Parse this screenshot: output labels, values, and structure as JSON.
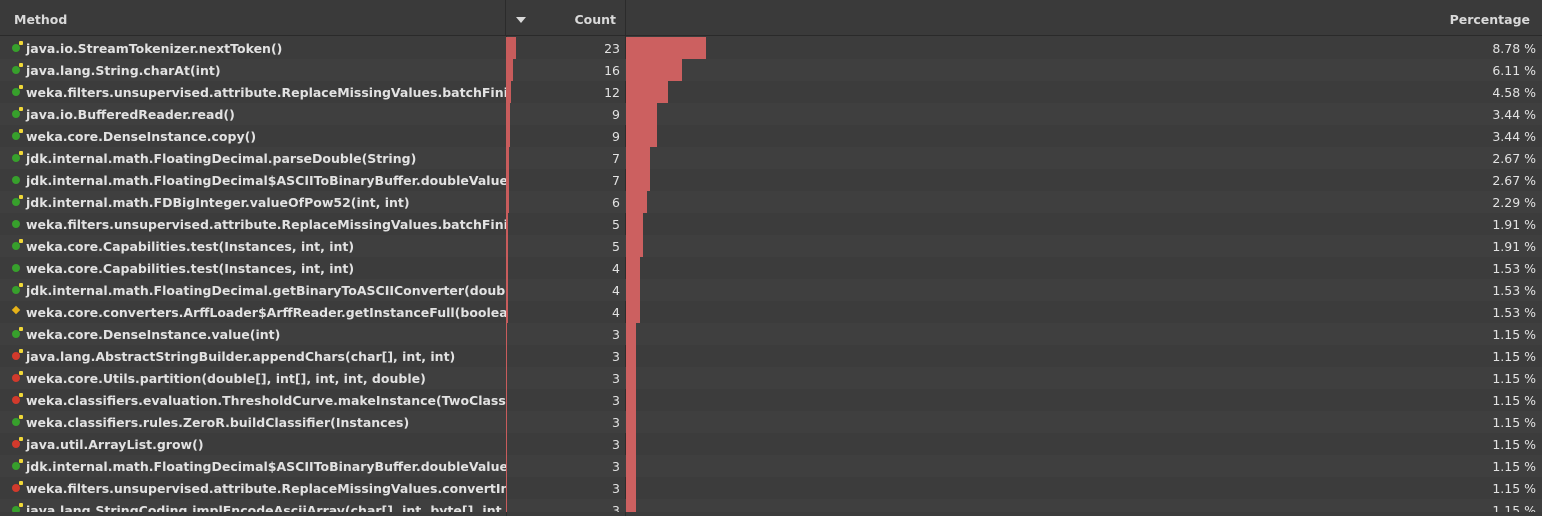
{
  "columns": {
    "method": "Method",
    "count": "Count",
    "percentage": "Percentage"
  },
  "rows": [
    {
      "method": "java.io.StreamTokenizer.nextToken()",
      "count": "23",
      "pct": "8.78 %",
      "frac": 0.0878,
      "icon": "green-arrow"
    },
    {
      "method": "java.lang.String.charAt(int)",
      "count": "16",
      "pct": "6.11 %",
      "frac": 0.0611,
      "icon": "green-arrow"
    },
    {
      "method": "weka.filters.unsupervised.attribute.ReplaceMissingValues.batchFinished()",
      "count": "12",
      "pct": "4.58 %",
      "frac": 0.0458,
      "icon": "green-arrow"
    },
    {
      "method": "java.io.BufferedReader.read()",
      "count": "9",
      "pct": "3.44 %",
      "frac": 0.0344,
      "icon": "green-arrow"
    },
    {
      "method": "weka.core.DenseInstance.copy()",
      "count": "9",
      "pct": "3.44 %",
      "frac": 0.0344,
      "icon": "green-arrow"
    },
    {
      "method": "jdk.internal.math.FloatingDecimal.parseDouble(String)",
      "count": "7",
      "pct": "2.67 %",
      "frac": 0.0267,
      "icon": "green-arrow"
    },
    {
      "method": "jdk.internal.math.FloatingDecimal$ASCIIToBinaryBuffer.doubleValue()",
      "count": "7",
      "pct": "2.67 %",
      "frac": 0.0267,
      "icon": "green"
    },
    {
      "method": "jdk.internal.math.FDBigInteger.valueOfPow52(int, int)",
      "count": "6",
      "pct": "2.29 %",
      "frac": 0.0229,
      "icon": "green-arrow"
    },
    {
      "method": "weka.filters.unsupervised.attribute.ReplaceMissingValues.batchFinished()",
      "count": "5",
      "pct": "1.91 %",
      "frac": 0.0191,
      "icon": "green"
    },
    {
      "method": "weka.core.Capabilities.test(Instances, int, int)",
      "count": "5",
      "pct": "1.91 %",
      "frac": 0.0191,
      "icon": "green-arrow"
    },
    {
      "method": "weka.core.Capabilities.test(Instances, int, int)",
      "count": "4",
      "pct": "1.53 %",
      "frac": 0.0153,
      "icon": "green"
    },
    {
      "method": "jdk.internal.math.FloatingDecimal.getBinaryToASCIIConverter(double)",
      "count": "4",
      "pct": "1.53 %",
      "frac": 0.0153,
      "icon": "green-arrow"
    },
    {
      "method": "weka.core.converters.ArffLoader$ArffReader.getInstanceFull(boolean)",
      "count": "4",
      "pct": "1.53 %",
      "frac": 0.0153,
      "icon": "yellow"
    },
    {
      "method": "weka.core.DenseInstance.value(int)",
      "count": "3",
      "pct": "1.15 %",
      "frac": 0.0115,
      "icon": "green-arrow"
    },
    {
      "method": "java.lang.AbstractStringBuilder.appendChars(char[], int, int)",
      "count": "3",
      "pct": "1.15 %",
      "frac": 0.0115,
      "icon": "red-arrow"
    },
    {
      "method": "weka.core.Utils.partition(double[], int[], int, int, double)",
      "count": "3",
      "pct": "1.15 %",
      "frac": 0.0115,
      "icon": "red-arrow"
    },
    {
      "method": "weka.classifiers.evaluation.ThresholdCurve.makeInstance(TwoClassStats, do",
      "count": "3",
      "pct": "1.15 %",
      "frac": 0.0115,
      "icon": "red-arrow"
    },
    {
      "method": "weka.classifiers.rules.ZeroR.buildClassifier(Instances)",
      "count": "3",
      "pct": "1.15 %",
      "frac": 0.0115,
      "icon": "green-arrow"
    },
    {
      "method": "java.util.ArrayList.grow()",
      "count": "3",
      "pct": "1.15 %",
      "frac": 0.0115,
      "icon": "red-arrow"
    },
    {
      "method": "jdk.internal.math.FloatingDecimal$ASCIIToBinaryBuffer.doubleValue()",
      "count": "3",
      "pct": "1.15 %",
      "frac": 0.0115,
      "icon": "green-arrow"
    },
    {
      "method": "weka.filters.unsupervised.attribute.ReplaceMissingValues.convertInstance(",
      "count": "3",
      "pct": "1.15 %",
      "frac": 0.0115,
      "icon": "red-arrow"
    },
    {
      "method": "java.lang.StringCoding.implEncodeAsciiArray(char[], int, byte[], int, int)",
      "count": "3",
      "pct": "1.15 %",
      "frac": 0.0115,
      "icon": "green-arrow"
    }
  ],
  "colors": {
    "bar": "#cc6060",
    "background": "#3c3c3c"
  }
}
